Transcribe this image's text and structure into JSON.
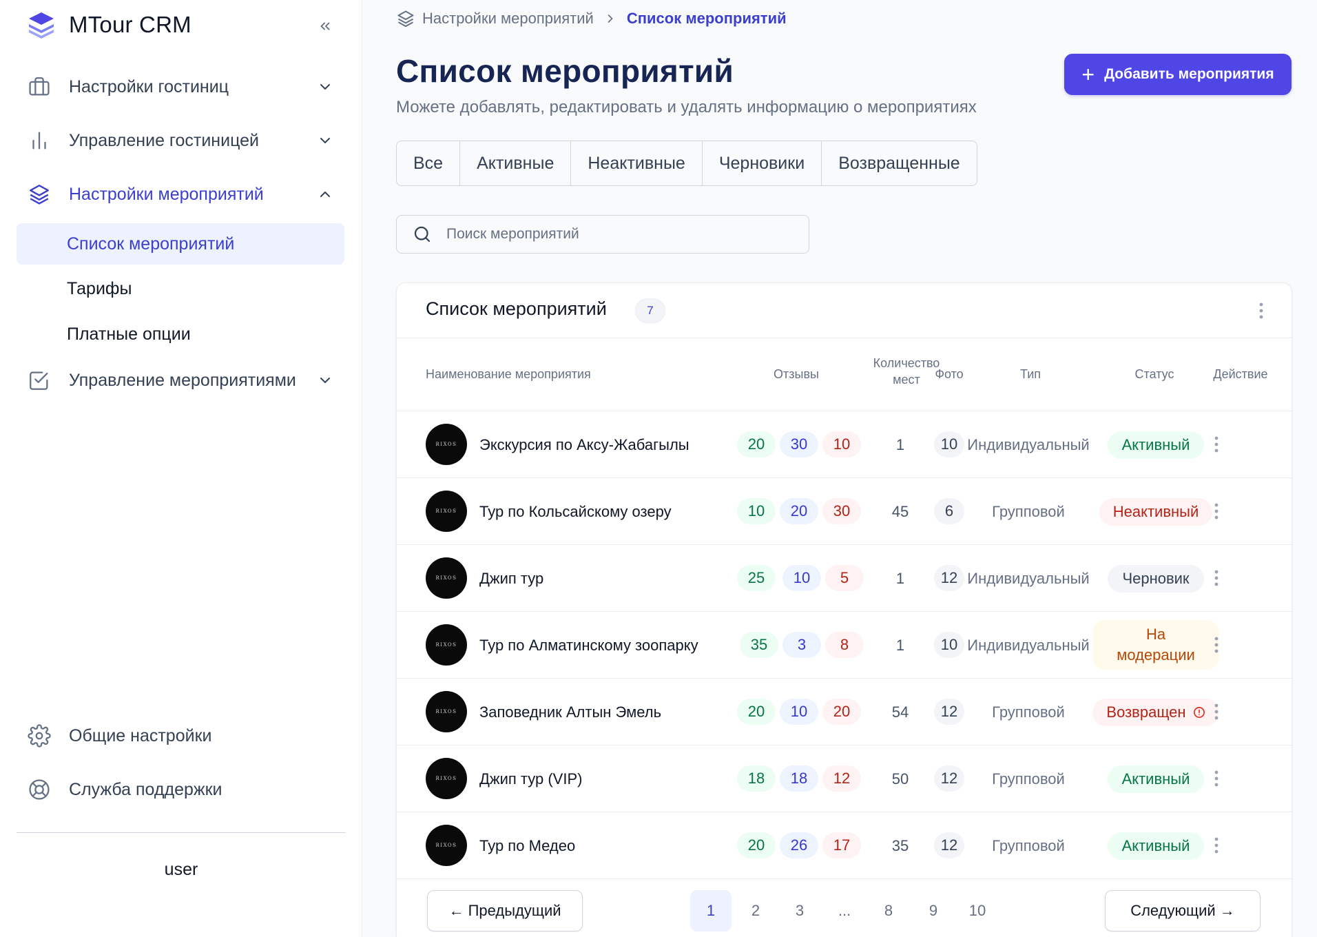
{
  "app": {
    "brand": "MTour CRM"
  },
  "sidebar": {
    "nav": [
      {
        "label": "Настройки гостиниц"
      },
      {
        "label": "Управление гостиницей"
      },
      {
        "label": "Настройки мероприятий"
      },
      {
        "label": "Управление мероприятиями"
      }
    ],
    "sub": [
      {
        "label": "Список мероприятий"
      },
      {
        "label": "Тарифы"
      },
      {
        "label": "Платные опции"
      }
    ],
    "bottom": [
      {
        "label": "Общие настройки"
      },
      {
        "label": "Служба поддержки"
      }
    ],
    "user": "user"
  },
  "breadcrumb": {
    "parent": "Настройки мероприятий",
    "current": "Список мероприятий"
  },
  "header": {
    "title": "Список мероприятий",
    "subtitle": "Можете добавлять, редактировать и удалять информацию о мероприятиях",
    "add_button": "Добавить мероприятия"
  },
  "tabs": [
    "Все",
    "Активные",
    "Неактивные",
    "Черновики",
    "Возвращенные"
  ],
  "search": {
    "placeholder": "Поиск мероприятий"
  },
  "table": {
    "title": "Список мероприятий",
    "count": "7",
    "columns": {
      "name": "Наименование мероприятия",
      "reviews": "Отзывы",
      "seats_1": "Количество",
      "seats_2": "мест",
      "photo": "Фото",
      "type": "Тип",
      "status": "Статус",
      "action": "Действие"
    },
    "avatar_text": "RIXOS",
    "rows": [
      {
        "name": "Экскурсия по Аксу-Жабагылы",
        "r1": "20",
        "r2": "30",
        "r3": "10",
        "seats": "1",
        "photo": "10",
        "type": "Индивидуальный",
        "status": "Активный",
        "status_kind": "active"
      },
      {
        "name": "Тур по Кольсайскому озеру",
        "r1": "10",
        "r2": "20",
        "r3": "30",
        "seats": "45",
        "photo": "6",
        "type": "Групповой",
        "status": "Неактивный",
        "status_kind": "inactive"
      },
      {
        "name": "Джип тур",
        "r1": "25",
        "r2": "10",
        "r3": "5",
        "seats": "1",
        "photo": "12",
        "type": "Индивидуальный",
        "status": "Черновик",
        "status_kind": "draft"
      },
      {
        "name": "Тур по Алматинскому зоопарку",
        "r1": "35",
        "r2": "3",
        "r3": "8",
        "seats": "1",
        "photo": "10",
        "type": "Индивидуальный",
        "status": "На модерации",
        "status_kind": "moder"
      },
      {
        "name": "Заповедник Алтын Эмель",
        "r1": "20",
        "r2": "10",
        "r3": "20",
        "seats": "54",
        "photo": "12",
        "type": "Групповой",
        "status": "Возвращен",
        "status_kind": "returned"
      },
      {
        "name": "Джип тур (VIP)",
        "r1": "18",
        "r2": "18",
        "r3": "12",
        "seats": "50",
        "photo": "12",
        "type": "Групповой",
        "status": "Активный",
        "status_kind": "active"
      },
      {
        "name": "Тур по Медео",
        "r1": "20",
        "r2": "26",
        "r3": "17",
        "seats": "35",
        "photo": "12",
        "type": "Групповой",
        "status": "Активный",
        "status_kind": "active"
      }
    ]
  },
  "pagination": {
    "prev": "← Предыдущий",
    "next": "Следующий →",
    "pages": [
      "1",
      "2",
      "3",
      "...",
      "8",
      "9",
      "10"
    ]
  },
  "colors": {
    "accent": "#4f46e5",
    "active_text": "#3b3fce",
    "title": "#172554"
  }
}
